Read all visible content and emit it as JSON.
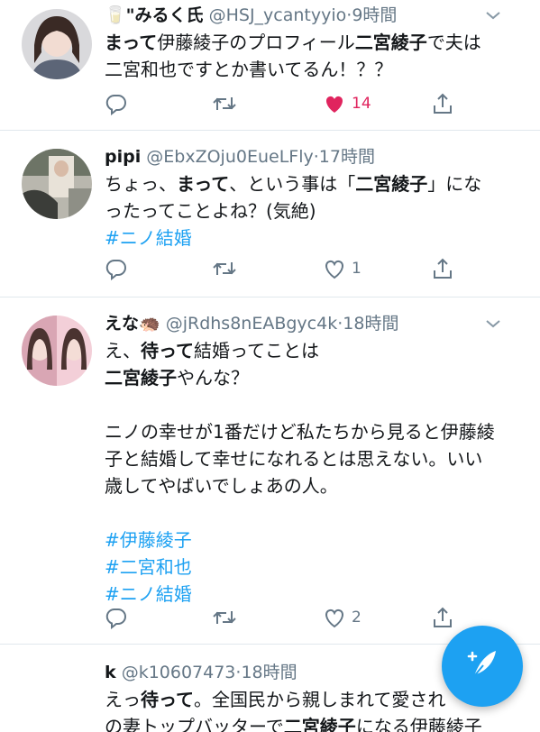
{
  "tweets": [
    {
      "name": "🥛\"みるく氏",
      "handle": "@HSJ_ycantyyio",
      "time": "9時間",
      "lines": [
        [
          {
            "t": "まって",
            "b": true
          },
          {
            "t": "伊藤綾子のプロフィール"
          },
          {
            "t": "二宮綾子",
            "b": true
          },
          {
            "t": "で夫は"
          }
        ],
        [
          {
            "t": "二宮和也ですとか書いてるん！？？"
          }
        ]
      ],
      "reply_count": "",
      "retweet_count": "",
      "like_count": "14",
      "liked": true
    },
    {
      "name": "pipi",
      "handle": "@EbxZOju0EueLFly",
      "time": "17時間",
      "lines": [
        [
          {
            "t": "ちょっ、"
          },
          {
            "t": "まって",
            "b": true
          },
          {
            "t": "、という事は「"
          },
          {
            "t": "二宮綾子",
            "b": true
          },
          {
            "t": "」にな"
          }
        ],
        [
          {
            "t": "ったってことよね？(気絶)"
          }
        ],
        [
          {
            "t": "#ニノ結婚",
            "tag": true
          }
        ]
      ],
      "reply_count": "",
      "retweet_count": "",
      "like_count": "1",
      "liked": false
    },
    {
      "name": "えな🦔",
      "handle": "@jRdhs8nEABgyc4k",
      "time": "18時間",
      "lines": [
        [
          {
            "t": "え、"
          },
          {
            "t": "待って",
            "b": true
          },
          {
            "t": "結婚ってことは"
          }
        ],
        [
          {
            "t": "二宮綾子",
            "b": true
          },
          {
            "t": "やんな？"
          }
        ],
        [],
        [
          {
            "t": "ニノの幸せが1番だけど私たちから見ると伊藤綾"
          }
        ],
        [
          {
            "t": "子と結婚して幸せになれるとは思えない。いい"
          }
        ],
        [
          {
            "t": "歳してやばいでしょあの人。"
          }
        ],
        [],
        [
          {
            "t": "#伊藤綾子",
            "tag": true
          }
        ],
        [
          {
            "t": "#二宮和也",
            "tag": true
          }
        ],
        [
          {
            "t": "#ニノ結婚",
            "tag": true
          }
        ]
      ],
      "reply_count": "",
      "retweet_count": "",
      "like_count": "2",
      "liked": false
    },
    {
      "name": "k",
      "handle": "@k10607473",
      "time": "18時間",
      "lines": [
        [
          {
            "t": "えっ"
          },
          {
            "t": "待って",
            "b": true
          },
          {
            "t": "。全国民から親しまれて愛され"
          }
        ],
        [
          {
            "t": "の妻トップバッターで"
          },
          {
            "t": "二宮綾子",
            "b": true
          },
          {
            "t": "になる伊藤綾子"
          }
        ]
      ]
    }
  ],
  "colors": {
    "accent": "#1da1f2",
    "like": "#e0245e",
    "muted": "#657786",
    "text": "#14171a"
  },
  "icons": {
    "reply": "reply-icon",
    "retweet": "retweet-icon",
    "like": "heart-icon",
    "share": "share-icon",
    "more": "chevron-down-icon",
    "compose": "compose-tweet-icon"
  }
}
